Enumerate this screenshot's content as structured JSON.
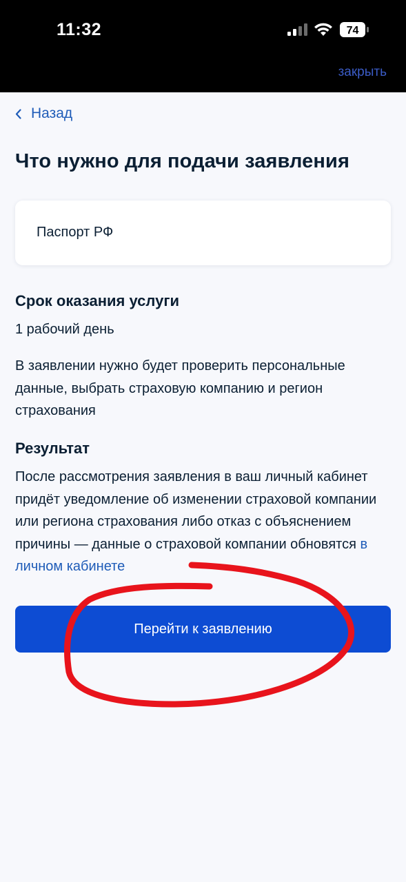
{
  "status_bar": {
    "time": "11:32",
    "battery_level": "74"
  },
  "header": {
    "close_label": "закрыть"
  },
  "nav": {
    "back_label": "Назад"
  },
  "page": {
    "title": "Что нужно для подачи заявления",
    "document_card": "Паспорт РФ",
    "term_heading": "Срок оказания услуги",
    "term_value": "1 рабочий день",
    "application_note": "В заявлении нужно будет проверить персональные данные, выбрать страховую компанию и регион страхования",
    "result_heading": "Результат",
    "result_text": "После рассмотрения заявления в ваш личный кабинет придёт уведомление об изменении страховой компании или региона страхования либо отказ с объяснением причины — данные о страховой компании обновятся ",
    "result_link": "в личном кабинете",
    "primary_button": "Перейти к заявлению"
  },
  "colors": {
    "accent": "#0d4cd3",
    "link": "#1f5cb8",
    "text": "#0b1f33",
    "background": "#f7f8fc",
    "annotation": "#e8141c"
  }
}
